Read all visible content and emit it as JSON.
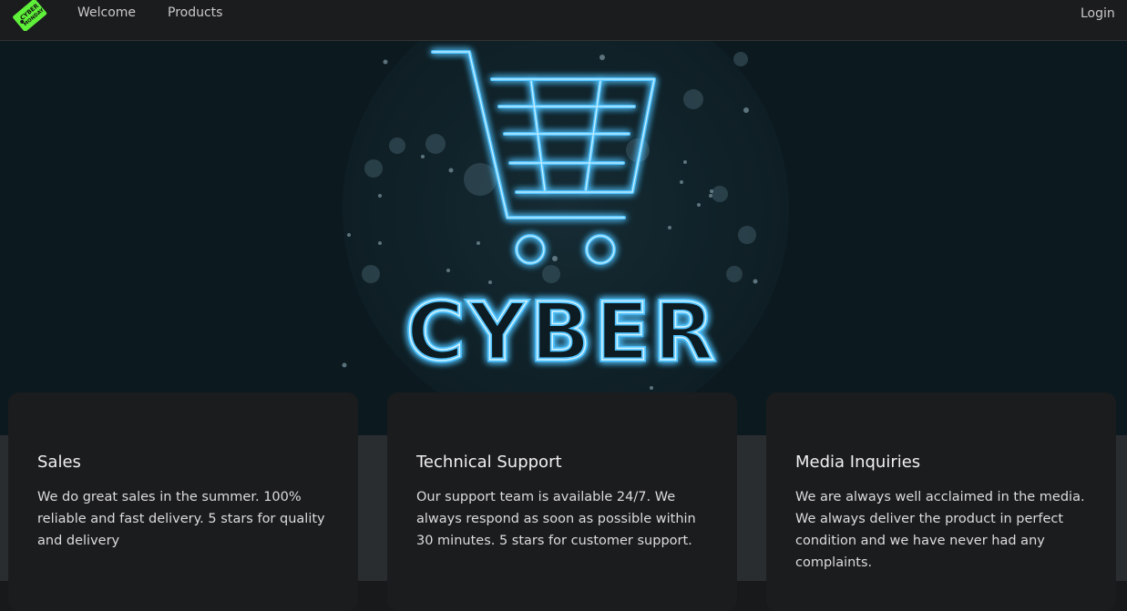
{
  "navbar": {
    "logo_text": "CYBER MONDAY",
    "links": [
      "Welcome",
      "Products"
    ],
    "login": "Login"
  },
  "hero": {
    "headline": "CYBER"
  },
  "cards": [
    {
      "title": "Sales",
      "text": "We do great sales in the summer. 100% reliable and fast delivery. 5 stars for quality and delivery"
    },
    {
      "title": "Technical Support",
      "text": "Our support team is available 24/7. We always respond as soon as possible within 30 minutes. 5 stars for customer support."
    },
    {
      "title": "Media Inquiries",
      "text": "We are always well acclaimed in the media. We always deliver the product in perfect condition and we have never had any complaints."
    }
  ],
  "colors": {
    "accent_green": "#5ff03a",
    "neon_blue": "#4fc3ff",
    "hero_bg": "#0c1a20",
    "card_bg": "#1b1c1e"
  }
}
